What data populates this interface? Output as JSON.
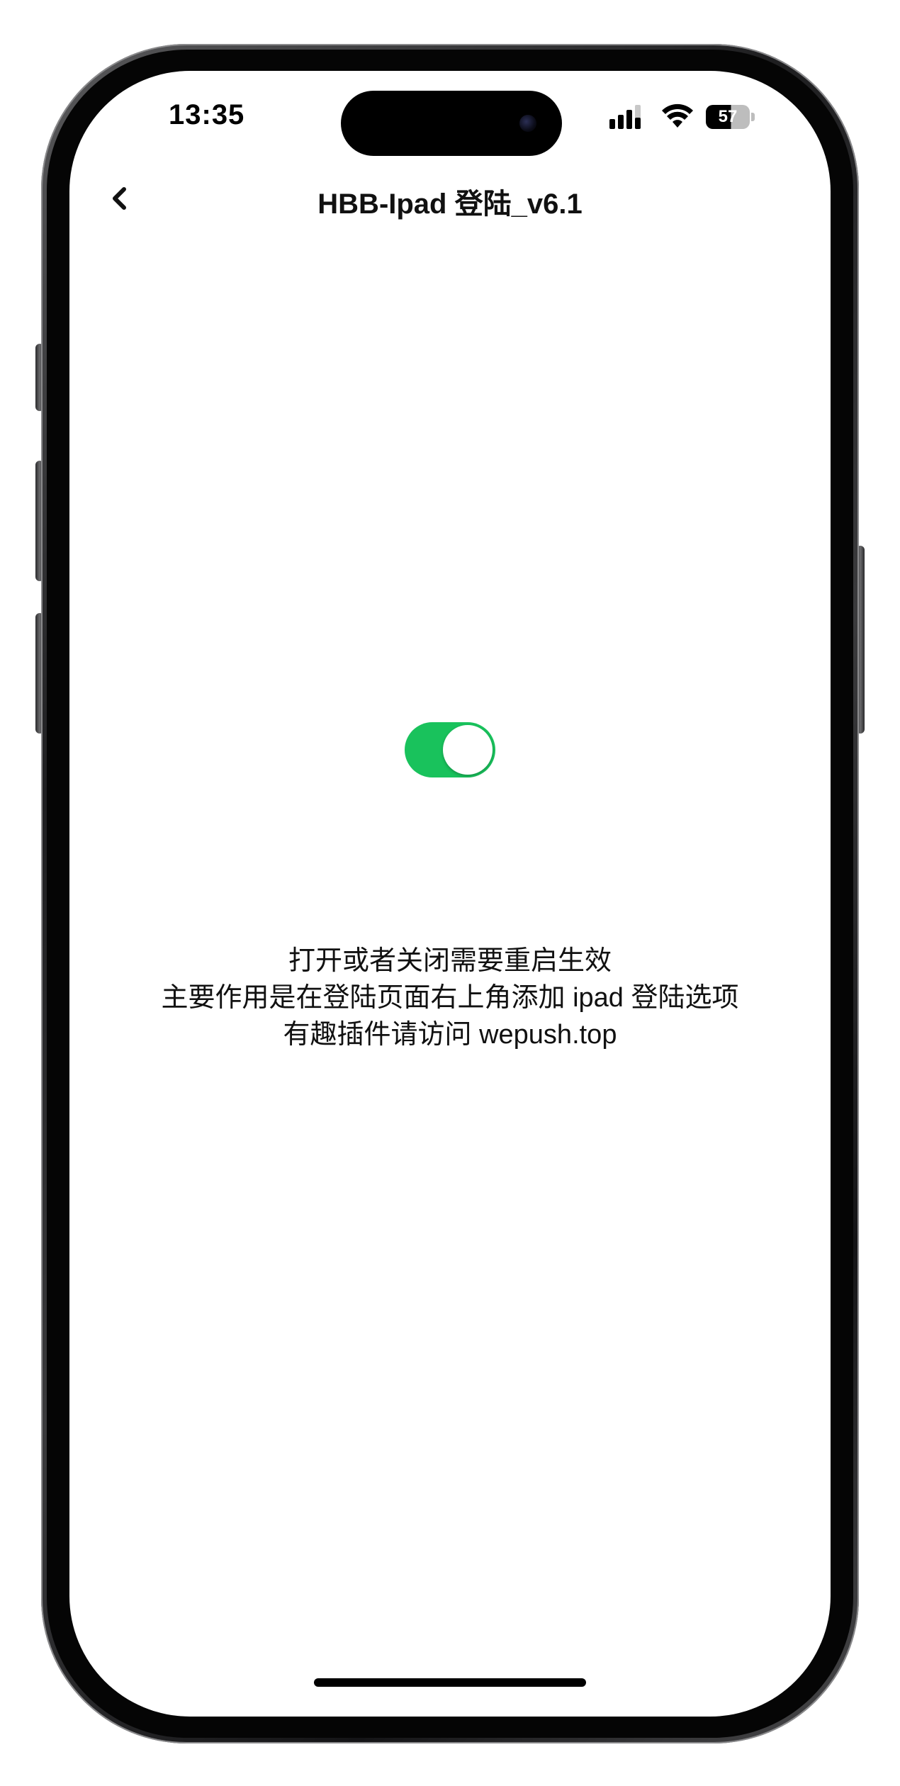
{
  "status_bar": {
    "time": "13:35",
    "battery": "57",
    "icons": [
      "signal-icon",
      "wifi-icon",
      "battery-icon"
    ]
  },
  "nav": {
    "back_icon": "chevron-left-icon",
    "title": "HBB-Ipad 登陆_v6.1"
  },
  "toggle": {
    "state": "on",
    "on_color": "#19c25c"
  },
  "info": {
    "line1": "打开或者关闭需要重启生效",
    "line2": "主要作用是在登陆页面右上角添加 ipad 登陆选项",
    "line3": "有趣插件请访问 wepush.top"
  }
}
